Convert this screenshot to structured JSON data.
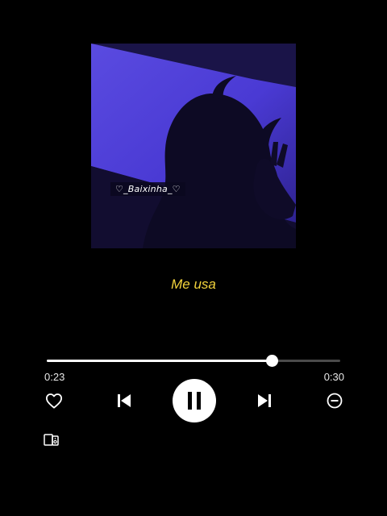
{
  "cover": {
    "watermark": "♡_Baixinha_♡"
  },
  "track": {
    "title": "Me usa"
  },
  "playback": {
    "elapsed": "0:23",
    "total": "0:30",
    "progress_fraction": 0.7667,
    "state": "playing"
  },
  "icons": {
    "like": "heart-outline-icon",
    "previous": "skip-previous-icon",
    "play_pause": "pause-icon",
    "next": "skip-next-icon",
    "hide": "minus-circle-icon",
    "devices": "connect-devices-icon"
  },
  "colors": {
    "background": "#000000",
    "title": "#f3d43c",
    "accent": "#ffffff",
    "track_inactive": "#4a4a4a"
  }
}
